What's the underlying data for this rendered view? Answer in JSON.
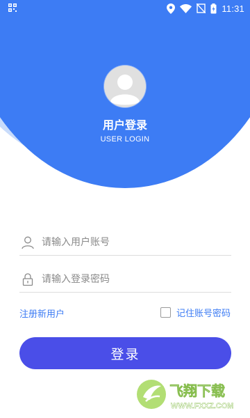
{
  "status_bar": {
    "time": "11:31"
  },
  "header": {
    "title": "用户登录",
    "subtitle": "USER LOGIN"
  },
  "form": {
    "username_placeholder": "请输入用户账号",
    "username_value": "",
    "password_placeholder": "请输入登录密码",
    "password_value": "",
    "register_label": "注册新用户",
    "remember_label": "记住账号密码",
    "remember_checked": false,
    "login_label": "登录"
  },
  "watermark": {
    "brand": "飞翔下载",
    "url": "WWW.FXXZ.COM"
  },
  "colors": {
    "primary_blue": "#3d7cf4",
    "light_blue": "#c9dcfb",
    "button": "#4a4ee8",
    "link": "#3d7cf4"
  },
  "icons": {
    "status_left": "qr-code-icon",
    "location": "location-icon",
    "wifi": "wifi-icon",
    "no_sim": "no-sim-icon",
    "battery": "battery-icon",
    "avatar": "user-avatar-icon",
    "user_field": "user-icon",
    "password_field": "lock-icon"
  }
}
